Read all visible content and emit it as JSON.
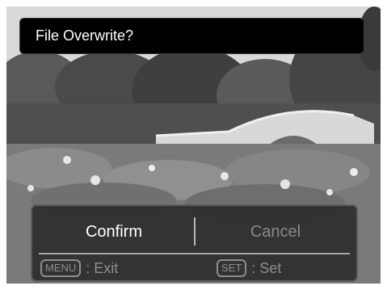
{
  "title_bar": {
    "text": "File Overwrite?"
  },
  "dialog": {
    "confirm_label": "Confirm",
    "cancel_label": "Cancel",
    "hint_left": {
      "key": "MENU",
      "action": ": Exit"
    },
    "hint_right": {
      "key": "SET",
      "action": ": Set"
    }
  },
  "colors": {
    "title_bg": "#000000",
    "dialog_bg": "#2d2d2d",
    "selected_text": "#ffffff",
    "inactive_text": "#8a8a8a"
  }
}
